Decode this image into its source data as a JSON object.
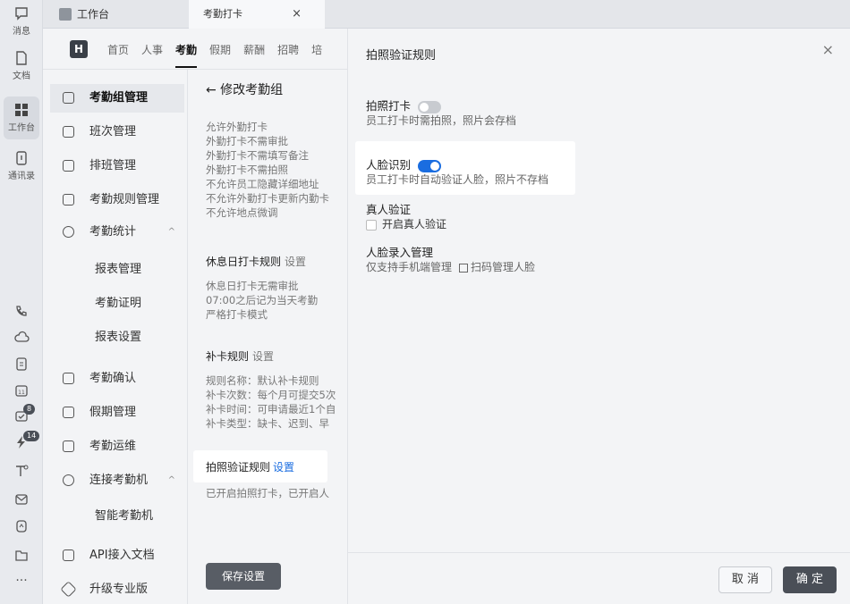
{
  "rail": {
    "items": [
      {
        "label": "消息",
        "icon": "message-icon"
      },
      {
        "label": "文档",
        "icon": "document-icon"
      },
      {
        "label": "工作台",
        "icon": "workbench-icon"
      },
      {
        "label": "通讯录",
        "icon": "contacts-icon"
      }
    ],
    "lower_icons": [
      "phone-icon",
      "cloud-icon",
      "clipboard-icon",
      "calendar-icon",
      "mail-check-icon",
      "flash-icon",
      "text-icon",
      "email-icon",
      "scan-icon",
      "folder-icon",
      "more-icon"
    ],
    "badges": {
      "mail-check": "8",
      "flash": "14"
    }
  },
  "tabs": [
    {
      "label": "工作台"
    },
    {
      "label": "考勤打卡",
      "close": "×"
    }
  ],
  "nav": {
    "logo": "H",
    "menu": [
      "首页",
      "人事",
      "考勤",
      "假期",
      "薪酬",
      "招聘",
      "培"
    ],
    "active": "考勤"
  },
  "sidebar": {
    "items": [
      {
        "label": "考勤组管理",
        "active": true
      },
      {
        "label": "班次管理"
      },
      {
        "label": "排班管理"
      },
      {
        "label": "考勤规则管理"
      },
      {
        "label": "考勤统计",
        "caret": "^"
      },
      {
        "label": "报表管理",
        "sub": true
      },
      {
        "label": "考勤证明",
        "sub": true
      },
      {
        "label": "报表设置",
        "sub": true
      },
      {
        "label": "考勤确认"
      },
      {
        "label": "假期管理"
      },
      {
        "label": "考勤运维"
      },
      {
        "label": "连接考勤机",
        "caret": "^"
      },
      {
        "label": "智能考勤机",
        "sub": true
      },
      {
        "label": "API接入文档"
      },
      {
        "label": "升级专业版"
      }
    ]
  },
  "content": {
    "back_title": "← 修改考勤组",
    "rules_lines": [
      "允许外勤打卡",
      "外勤打卡不需审批",
      "外勤打卡不需填写备注",
      "外勤打卡不需拍照",
      "不允许员工隐藏详细地址",
      "不允许外勤打卡更新内勤卡",
      "不允许地点微调"
    ],
    "holiday": {
      "title": "休息日打卡规则",
      "link": "设置",
      "lines": [
        "休息日打卡无需审批",
        "07:00之后记为当天考勤",
        "严格打卡模式"
      ]
    },
    "makeup": {
      "title": "补卡规则",
      "link": "设置",
      "lines": [
        "规则名称：默认补卡规则",
        "补卡次数：每个月可提交5次",
        "补卡时间：可申请最近1个自",
        "补卡类型：缺卡、迟到、早"
      ]
    },
    "photo": {
      "title": "拍照验证规则",
      "link": "设置",
      "line": "已开启拍照打卡，已开启人"
    },
    "save_label": "保存设置"
  },
  "panel": {
    "title": "拍照验证规则",
    "close": "×",
    "photo_clock": {
      "label": "拍照打卡",
      "on": false,
      "desc": "员工打卡时需拍照，照片会存档"
    },
    "face": {
      "label": "人脸识别",
      "on": true,
      "desc": "员工打卡时自动验证人脸，照片不存档"
    },
    "real_person": {
      "label": "真人验证",
      "checkbox_label": "开启真人验证",
      "checked": false
    },
    "face_entry": {
      "label": "人脸录入管理",
      "desc": "仅支持手机端管理",
      "qr_label": "扫码管理人脸"
    },
    "cancel_label": "取 消",
    "ok_label": "确 定"
  },
  "colors": {
    "accent": "#1a6de0",
    "dark_button": "#4a4f57"
  }
}
